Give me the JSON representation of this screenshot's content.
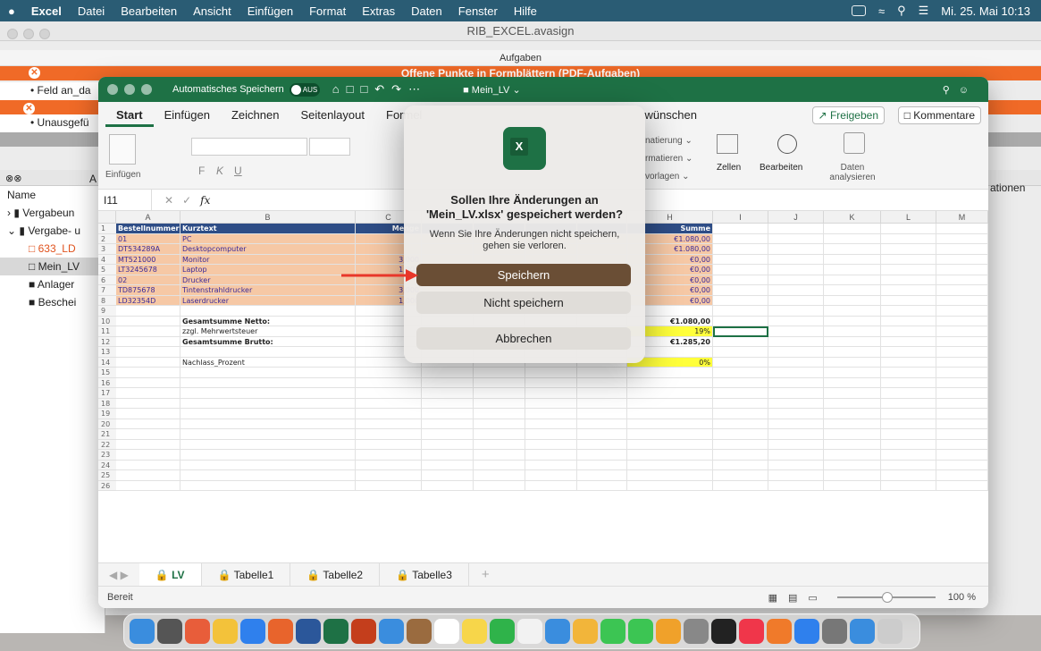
{
  "menubar": {
    "items": [
      "Excel",
      "Datei",
      "Bearbeiten",
      "Ansicht",
      "Einfügen",
      "Format",
      "Extras",
      "Daten",
      "Fenster",
      "Hilfe"
    ],
    "clock": "Mi. 25. Mai 10:13"
  },
  "bg_window": {
    "title": "RIB_EXCEL.avasign",
    "panel_title": "Aufgaben",
    "red_bar_title": "Offene Punkte in Formblättern (PDF-Aufgaben)",
    "item_1": "Feld an_da",
    "item_2": "Unausgefü",
    "tree_header": "Name",
    "tree": [
      "Vergabeun",
      "Vergabe- u",
      "633_LD",
      "Mein_LV",
      "Anlager",
      "Beschei"
    ],
    "right_fragment": "ationen",
    "A_fragment": "A"
  },
  "excel": {
    "autosave_label": "Automatisches Speichern",
    "autosave_state": "AUS",
    "doc_title": "Mein_LV",
    "tabs": [
      "Start",
      "Einfügen",
      "Zeichnen",
      "Seitenlayout",
      "Formel"
    ],
    "tab_fragment": "wünschen",
    "share": "Freigeben",
    "comments": "Kommentare",
    "ribbon": {
      "paste": "Einfügen",
      "bold": "F",
      "italic": "K",
      "underline": "U",
      "cond_1": "natierung ⌄",
      "cond_2": "rmatieren ⌄",
      "cond_3": "vorlagen ⌄",
      "cells": "Zellen",
      "editing": "Bearbeiten",
      "analyze": "Daten analysieren"
    },
    "namebox": "I11",
    "fx": "fx",
    "columns": [
      "A",
      "B",
      "C",
      "D",
      "E",
      "F",
      "G",
      "H",
      "I",
      "J",
      "K",
      "L",
      "M"
    ],
    "rows": [
      "1",
      "2",
      "3",
      "4",
      "5",
      "6",
      "7",
      "8",
      "9",
      "10",
      "11",
      "12",
      "13",
      "14",
      "15",
      "16",
      "17",
      "18",
      "19",
      "20",
      "21",
      "22",
      "23",
      "24",
      "25",
      "26"
    ],
    "hdr": {
      "a": "Bestellnummer",
      "b": "Kurztext",
      "c": "Menge",
      "h": "Summe"
    },
    "items": [
      {
        "a": "01",
        "b": "PC",
        "c": "",
        "h": "€1.080,00"
      },
      {
        "a": "DT534289A",
        "b": "Desktopcomputer",
        "c": "",
        "h": "€1.080,00"
      },
      {
        "a": "MT521000",
        "b": "Monitor",
        "c": "3,000",
        "h": "€0,00"
      },
      {
        "a": "LT3245678",
        "b": "Laptop",
        "c": "1,000",
        "h": "€0,00"
      },
      {
        "a": "02",
        "b": "Drucker",
        "c": "",
        "h": "€0,00"
      },
      {
        "a": "TD875678",
        "b": "Tintenstrahldrucker",
        "c": "3,000",
        "h": "€0,00"
      },
      {
        "a": "LD32354D",
        "b": "Laserdrucker",
        "c": "1,000",
        "h": "€0,00"
      }
    ],
    "netto_label": "Gesamtsumme Netto:",
    "netto": "€1.080,00",
    "mwst_label": "zzgl. Mehrwertsteuer",
    "mwst": "19%",
    "brutto_label": "Gesamtsumme Brutto:",
    "brutto": "€1.285,20",
    "nachlass_label": "Nachlass_Prozent",
    "nachlass": "0%",
    "sheets": [
      "LV",
      "Tabelle1",
      "Tabelle2",
      "Tabelle3"
    ],
    "add_sheet": "+",
    "status": "Bereit",
    "zoom": "100 %"
  },
  "dialog": {
    "title": "Sollen Ihre Änderungen an 'Mein_LV.xlsx' gespeichert werden?",
    "message": "Wenn Sie Ihre Änderungen nicht speichern, gehen sie verloren.",
    "save": "Speichern",
    "dont_save": "Nicht speichern",
    "cancel": "Abbrechen"
  },
  "colors": {
    "excel_green": "#1e7145",
    "header_blue": "#2e4d86",
    "row_fill": "#f6c8a5",
    "highlight": "#ffff3b",
    "dialog_primary": "#6a4e35",
    "notice": "#f06a27"
  },
  "dock_icons": [
    "finder-icon",
    "launchpad-icon",
    "photos-icon",
    "grid-icon",
    "safari-icon",
    "firefox-icon",
    "word-icon",
    "excel-icon",
    "powerpoint-icon",
    "mail-icon",
    "contacts-icon",
    "calendar-icon",
    "notes-icon",
    "numbers-icon",
    "reminders-icon",
    "keynote-icon",
    "photos2-icon",
    "messages-icon",
    "facetime-icon",
    "pages-icon",
    "system-icon",
    "stocks-icon",
    "music-icon",
    "books-icon",
    "appstore-icon",
    "settings-icon",
    "preview-icon",
    "trash-icon"
  ]
}
